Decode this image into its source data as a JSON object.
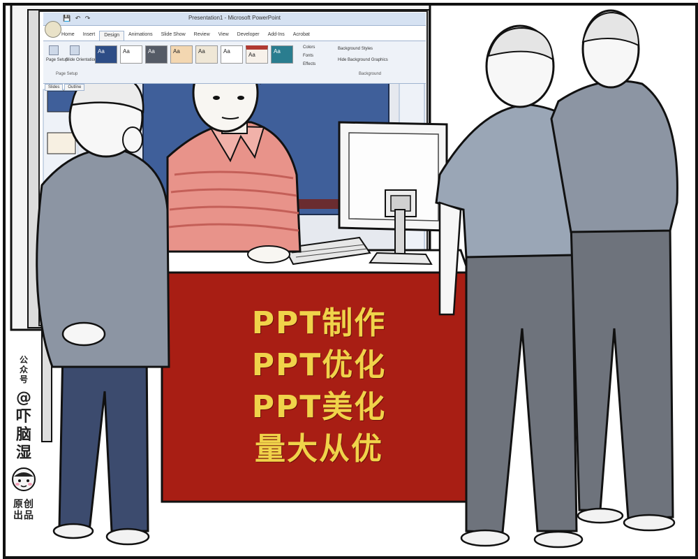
{
  "powerpoint": {
    "title": "Presentation1 - Microsoft PowerPoint",
    "tabs": [
      "Home",
      "Insert",
      "Design",
      "Animations",
      "Slide Show",
      "Review",
      "View",
      "Developer",
      "Add-Ins",
      "Acrobat"
    ],
    "active_tab": "Design",
    "ribbon": {
      "page_setup": "Page Setup",
      "slide_orientation": "Slide Orientation",
      "page_setup_group": "Page Setup",
      "themes": [
        "Aa",
        "Aa",
        "Aa",
        "Aa",
        "Aa",
        "Aa",
        "Aa",
        "Aa"
      ],
      "colors": "Colors",
      "fonts": "Fonts",
      "effects": "Effects",
      "background_styles": "Background Styles",
      "hide_background_graphics": "Hide Background Graphics",
      "background_group": "Background"
    },
    "panel_tabs": [
      "Slides",
      "Outline"
    ]
  },
  "sign": {
    "lines": [
      "PPT制作",
      "PPT优化",
      "PPT美化",
      "量大从优"
    ],
    "text_color": "#f0d34a",
    "background_color": "#a81e14"
  },
  "watermark": {
    "prefix": "公众号",
    "at": "@",
    "name": [
      "吓",
      "脑",
      "湿"
    ],
    "suffix": [
      "原创",
      "出品"
    ]
  },
  "colors": {
    "slide_blue": "#3f5f9a",
    "shirt_pink": "#e8938a",
    "jacket_gray": "#8c95a3",
    "pants_navy": "#3c4b6e",
    "shirt_blue_gray": "#9aa6b6",
    "pants_gray": "#6e737c"
  }
}
